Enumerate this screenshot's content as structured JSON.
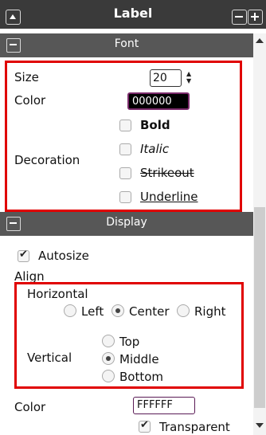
{
  "window": {
    "title": "Label"
  },
  "font_section": {
    "header": "Font",
    "size_label": "Size",
    "size_value": "20",
    "color_label": "Color",
    "color_value": "000000",
    "decoration_label": "Decoration",
    "decorations": [
      {
        "label": "Bold",
        "checked": false
      },
      {
        "label": "Italic",
        "checked": false
      },
      {
        "label": "Strikeout",
        "checked": false
      },
      {
        "label": "Underline",
        "checked": false
      }
    ]
  },
  "display_section": {
    "header": "Display",
    "autosize_label": "Autosize",
    "autosize_checked": true,
    "align_label": "Align",
    "horizontal_label": "Horizontal",
    "horizontal_options": [
      "Left",
      "Center",
      "Right"
    ],
    "horizontal_selected": "Center",
    "vertical_label": "Vertical",
    "vertical_options": [
      "Top",
      "Middle",
      "Bottom"
    ],
    "vertical_selected": "Middle",
    "color_label": "Color",
    "color_value": "FFFFFF",
    "transparent_label": "Transparent",
    "transparent_checked": true
  },
  "colors": {
    "titlebar": "#3a3a3a",
    "section_header": "#575757",
    "highlight": "#e00000"
  }
}
